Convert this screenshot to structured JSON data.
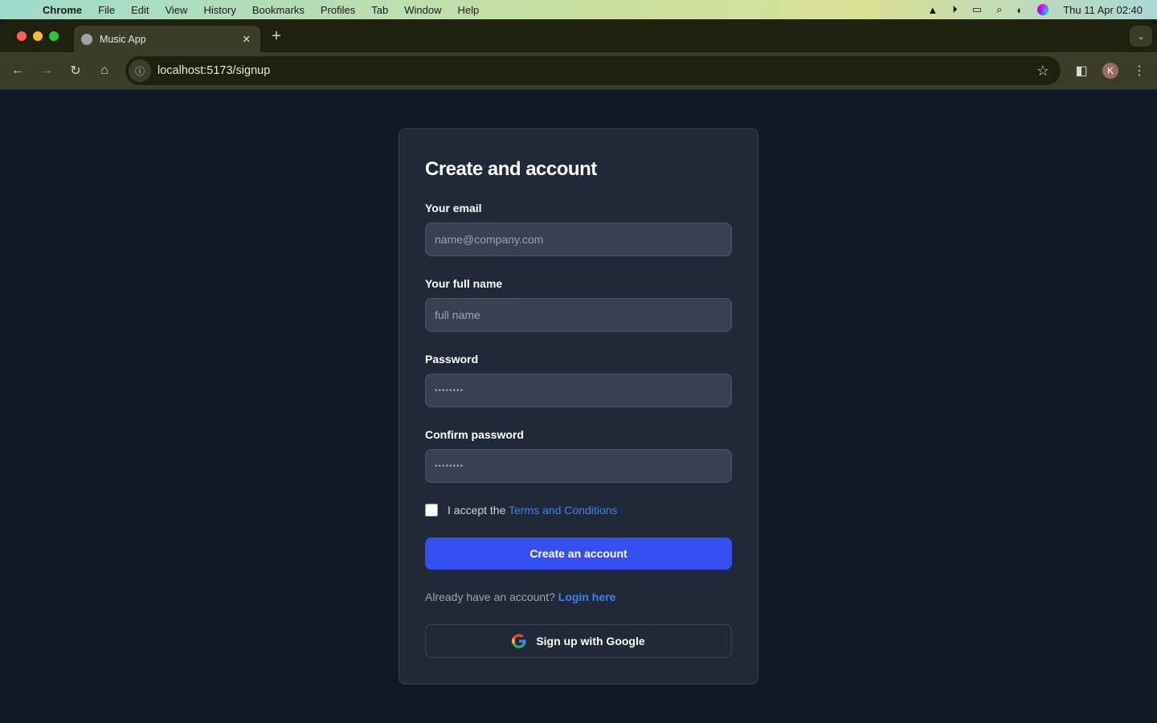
{
  "menubar": {
    "app": "Chrome",
    "items": [
      "File",
      "Edit",
      "View",
      "History",
      "Bookmarks",
      "Profiles",
      "Tab",
      "Window",
      "Help"
    ],
    "datetime": "Thu 11 Apr  02:40"
  },
  "browser": {
    "tab_title": "Music App",
    "url": "localhost:5173/signup",
    "profile_initial": "K"
  },
  "form": {
    "title": "Create and account",
    "email": {
      "label": "Your email",
      "placeholder": "name@company.com"
    },
    "name": {
      "label": "Your full name",
      "placeholder": "full name"
    },
    "password": {
      "label": "Password",
      "value": "••••••••"
    },
    "confirm": {
      "label": "Confirm password",
      "value": "••••••••"
    },
    "terms_prefix": "I accept the ",
    "terms_link": "Terms and Conditions",
    "submit": "Create an account",
    "login_prefix": "Already have an account? ",
    "login_link": "Login here",
    "google": "Sign up with Google"
  },
  "colors": {
    "accent": "#364ff0",
    "link": "#3b82f6",
    "card": "#1f2937",
    "page": "#111827"
  }
}
